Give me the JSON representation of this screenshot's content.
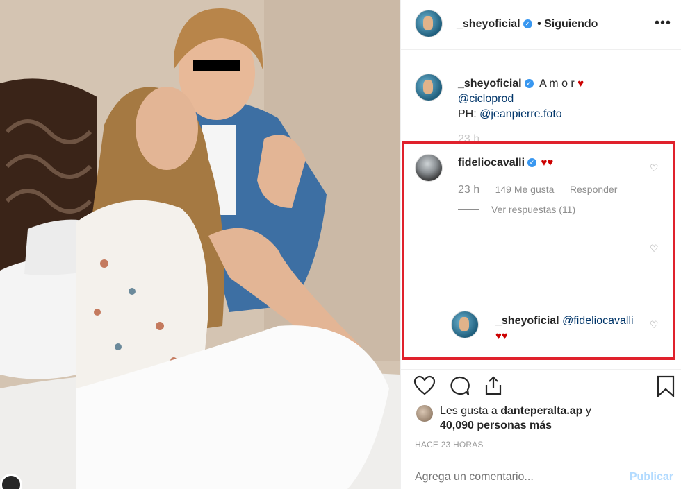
{
  "post": {
    "header": {
      "username": "_sheyoficial",
      "separator": "•",
      "follow_status": "Siguiendo",
      "more_icon": "more-horizontal-icon"
    },
    "caption": {
      "username": "_sheyoficial",
      "text": "A m o r",
      "heart": "♥",
      "mention1": "@cicloprod",
      "ph_prefix": "PH:",
      "mention2": "@jeanpierre.foto",
      "time": "23 h"
    },
    "comments": [
      {
        "username": "fideliocavalli",
        "text": "♥♥",
        "time": "23 h",
        "likes": "149 Me gusta",
        "reply": "Responder",
        "view_replies": "Ver respuestas (11)"
      }
    ],
    "reply": {
      "username": "_sheyoficial",
      "mention": "@fideliocavalli",
      "text": "♥♥"
    },
    "likes": {
      "line1_prefix": "Les gusta a",
      "liker": "danteperalta.ap",
      "line1_suffix": "y",
      "line2": "40,090 personas más"
    },
    "timestamp": "HACE 23 HORAS",
    "comment_input": {
      "placeholder": "Agrega un comentario...",
      "publish": "Publicar"
    }
  },
  "colors": {
    "highlight": "#e0212c",
    "verified": "#3897f0",
    "mention": "#003569",
    "heart": "#cc0000",
    "publish_disabled": "#b3dbff"
  }
}
